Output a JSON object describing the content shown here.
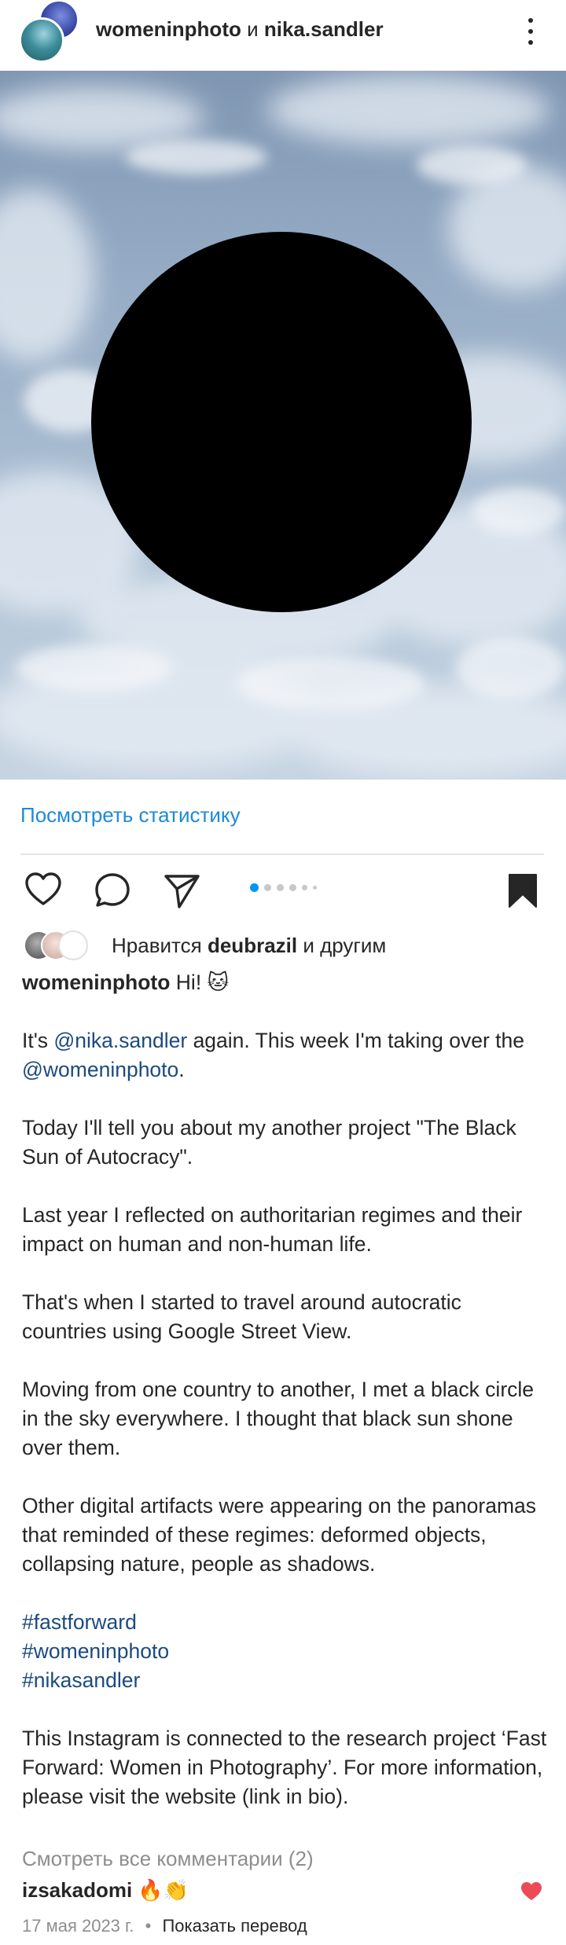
{
  "header": {
    "user1": "womeninphoto",
    "conj": "и",
    "user2": "nika.sandler"
  },
  "stats_link": "Посмотреть статистику",
  "carousel": {
    "count": 6,
    "active_index": 0
  },
  "likes": {
    "prefix": "Нравится",
    "user": "deubrazil",
    "suffix": "и другим"
  },
  "caption": {
    "username": "womeninphoto",
    "greeting": "Hi! 🐱",
    "p1a": "It's ",
    "mention1": "@nika.sandler",
    "p1b": " again. This week I'm taking over the ",
    "mention2": "@womeninphoto",
    "p1c": ".",
    "p2": "Today I'll tell you about my another project \"The Black Sun of Autocracy\".",
    "p3": "Last year I reflected on authoritarian regimes and their impact on human and non-human life.",
    "p4": "That's when I started to travel around autocratic countries using Google Street View.",
    "p5": "Moving from one country to another, I met a black circle in the sky everywhere. I thought that black sun shone over them.",
    "p6": "Other digital artifacts were appearing on the panoramas that reminded of these regimes: deformed objects, collapsing nature, people as shadows.",
    "hashtags": [
      "#fastforward",
      "#womeninphoto",
      "#nikasandler"
    ],
    "p7": "This Instagram is connected to the research project ‘Fast Forward: Women in Photography’. For more information, please visit the website (link in bio)."
  },
  "view_comments": "Смотреть все комментарии (2)",
  "comment": {
    "user": "izsakadomi",
    "text": "🔥👏"
  },
  "meta": {
    "date": "17 мая 2023 г.",
    "separator": "•",
    "translate": "Показать перевод"
  },
  "colors": {
    "link_blue": "#1c8ad8",
    "mention_blue": "#1c4a80",
    "heart_red": "#ed4956"
  },
  "icons": [
    "more-vert-icon",
    "heart-icon",
    "comment-icon",
    "share-icon",
    "bookmark-icon",
    "heart-filled-icon"
  ]
}
